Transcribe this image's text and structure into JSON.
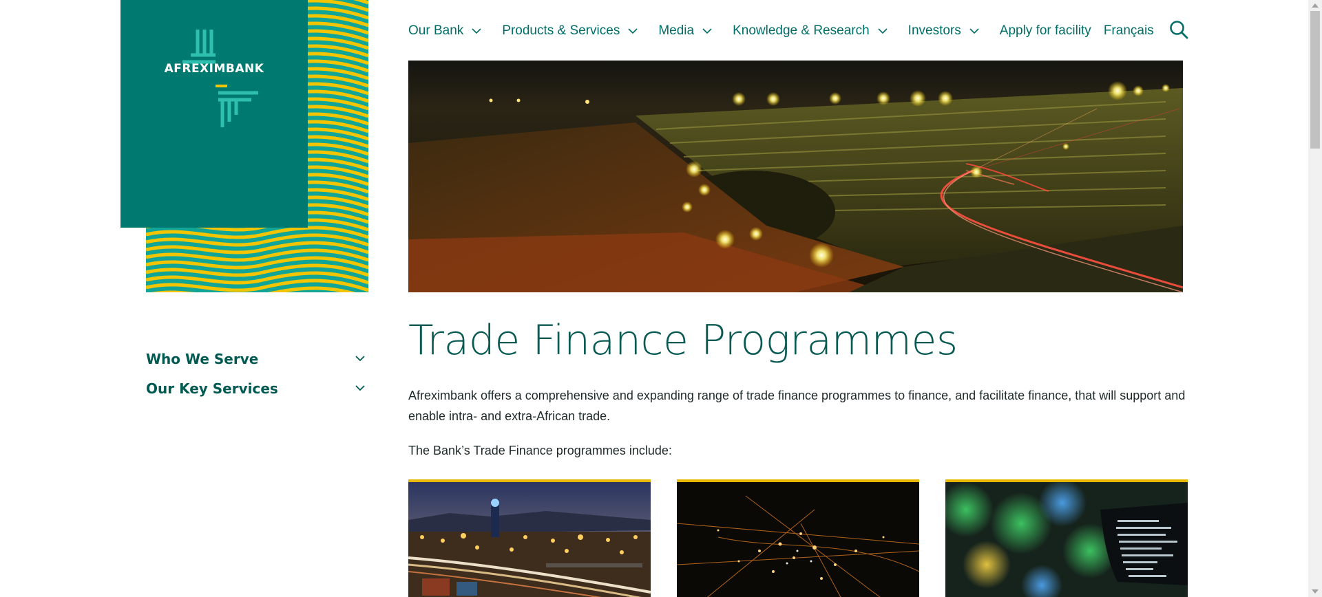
{
  "brand": {
    "name": "AFREXIMBANK",
    "tile_color": "#007a70",
    "wave_colors": [
      "#f2c500",
      "#10a596"
    ]
  },
  "nav": {
    "items": [
      {
        "label": "Our Bank",
        "has_dropdown": true
      },
      {
        "label": "Products & Services",
        "has_dropdown": true
      },
      {
        "label": "Media",
        "has_dropdown": true
      },
      {
        "label": "Knowledge & Research",
        "has_dropdown": true
      },
      {
        "label": "Investors",
        "has_dropdown": true
      },
      {
        "label": "Apply for facility",
        "has_dropdown": false
      },
      {
        "label": "Français",
        "has_dropdown": false
      }
    ],
    "search_icon": "search-icon",
    "link_color": "#006e66"
  },
  "hero": {
    "image": "open-pit-mine-at-night"
  },
  "side_menu": {
    "items": [
      {
        "label": "Who We Serve",
        "icon": "chevron-down-icon"
      },
      {
        "label": "Our Key Services",
        "icon": "chevron-down-icon"
      }
    ]
  },
  "main": {
    "title": "Trade Finance Programmes",
    "intro": "Afreximbank offers a comprehensive and expanding range of trade finance programmes to finance, and facilitate finance, that will support and enable intra- and extra-African trade.",
    "subintro": "The Bank’s Trade Finance programmes include:",
    "cards": [
      {
        "image": "port-highway-at-night"
      },
      {
        "image": "city-lights-aerial"
      },
      {
        "image": "code-on-screen"
      }
    ],
    "accent_color": "#e8b800"
  }
}
